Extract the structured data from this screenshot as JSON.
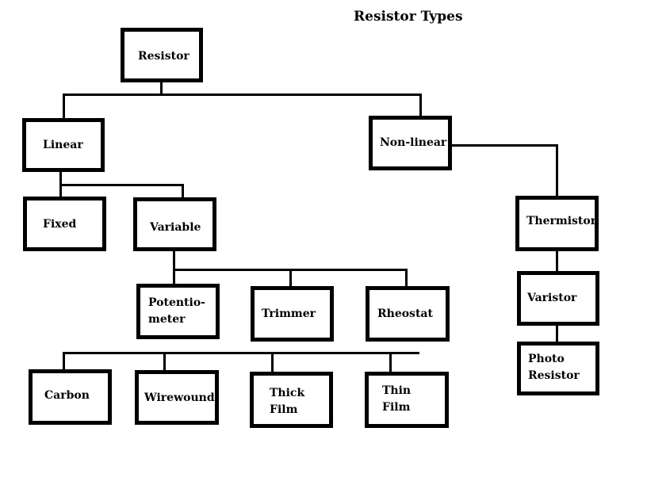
{
  "title": "Resistor Types",
  "nodes": {
    "resistor": "Resistor",
    "linear": "Linear",
    "nonlinear": "Non-linear",
    "fixed": "Fixed",
    "variable": "Variable",
    "potentiometer": "Potentio-\nmeter",
    "trimmer": "Trimmer",
    "rheostat": "Rheostat",
    "carbon": "Carbon",
    "wirewound": "Wirewound",
    "thick_film": "Thick\nFilm",
    "thin_film": "Thin\nFilm",
    "thermistor": "Thermistor",
    "varistor": "Varistor",
    "photo_resistor": "Photo\nResistor"
  },
  "edges": [
    [
      "Resistor",
      "Linear"
    ],
    [
      "Resistor",
      "Non-linear"
    ],
    [
      "Linear",
      "Fixed"
    ],
    [
      "Linear",
      "Variable"
    ],
    [
      "Variable",
      "Potentiometer"
    ],
    [
      "Variable",
      "Trimmer"
    ],
    [
      "Variable",
      "Rheostat"
    ],
    [
      "Fixed",
      "Carbon"
    ],
    [
      "Fixed",
      "Wirewound"
    ],
    [
      "Fixed",
      "Thick Film"
    ],
    [
      "Fixed",
      "Thin Film"
    ],
    [
      "Non-linear",
      "Thermistor"
    ],
    [
      "Thermistor",
      "Varistor"
    ],
    [
      "Varistor",
      "Photo Resistor"
    ]
  ]
}
